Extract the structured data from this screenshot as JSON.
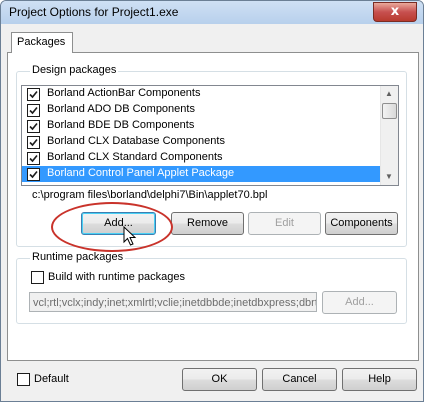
{
  "window": {
    "title": "Project Options for Project1.exe",
    "close_glyph": "x"
  },
  "tabs": [
    "Packages"
  ],
  "design_packages": {
    "legend": "Design packages",
    "items": [
      {
        "label": "Borland ActionBar Components",
        "checked": true,
        "selected": false
      },
      {
        "label": "Borland ADO DB Components",
        "checked": true,
        "selected": false
      },
      {
        "label": "Borland BDE DB Components",
        "checked": true,
        "selected": false
      },
      {
        "label": "Borland CLX Database Components",
        "checked": true,
        "selected": false
      },
      {
        "label": "Borland CLX Standard Components",
        "checked": true,
        "selected": false
      },
      {
        "label": "Borland Control Panel Applet Package",
        "checked": true,
        "selected": true
      }
    ],
    "path": "c:\\program files\\borland\\delphi7\\Bin\\applet70.bpl",
    "buttons": {
      "add": "Add...",
      "remove": "Remove",
      "edit": "Edit",
      "components": "Components"
    }
  },
  "runtime_packages": {
    "legend": "Runtime packages",
    "build_label": "Build with runtime packages",
    "build_checked": false,
    "packages_value": "vcl;rtl;vclx;indy;inet;xmlrtl;vclie;inetdbbde;inetdbxpress;dbrtl;d",
    "add_label": "Add..."
  },
  "footer": {
    "default_label": "Default",
    "default_checked": false,
    "ok_label": "OK",
    "cancel_label": "Cancel",
    "help_label": "Help"
  },
  "colors": {
    "selection": "#3399ff",
    "annotation_circle": "#c9332b"
  },
  "icons": [
    "close-icon",
    "checkbox-checked-icon",
    "scroll-up-arrow-icon",
    "scroll-down-arrow-icon",
    "mouse-pointer-icon"
  ]
}
